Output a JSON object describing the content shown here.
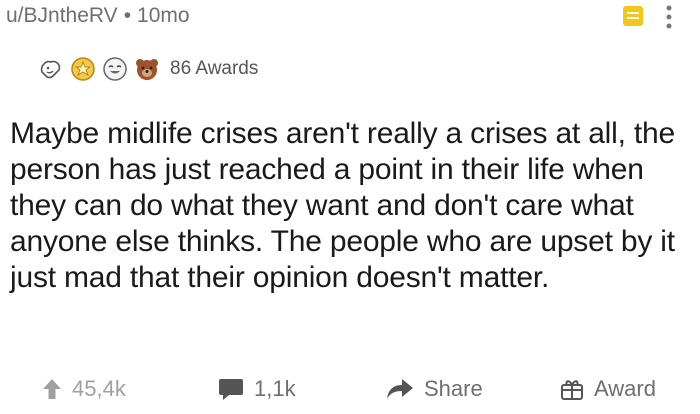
{
  "post": {
    "author": "u/BJntheRV",
    "separator": "•",
    "age": "10mo",
    "awards": {
      "icons": [
        "wholesome-icon",
        "gold-award-icon",
        "laughing-face-icon",
        "bear-award-icon"
      ],
      "count_label": "86 Awards"
    },
    "text": "Maybe midlife crises aren't really a crises at all, the person has just reached a point in their life when they can do what they want and don't care what anyone else thinks. The people who are upset by it just mad that their opinion doesn't matter.",
    "actions": {
      "upvotes": "45,4k",
      "comments": "1,1k",
      "share_label": "Share",
      "award_label": "Award"
    }
  },
  "colors": {
    "save_icon": "#f5c518",
    "meta_text": "#6f6f6f"
  }
}
